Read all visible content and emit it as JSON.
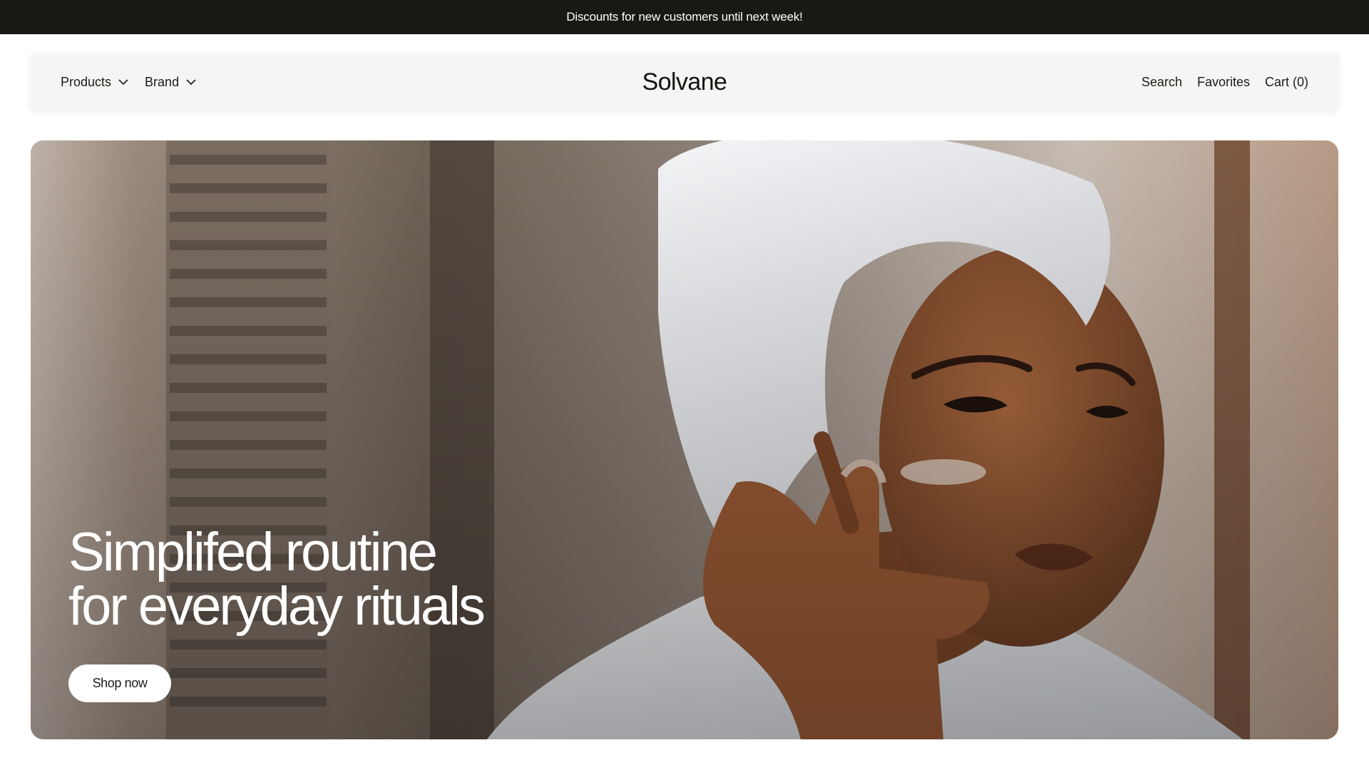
{
  "announcement": {
    "text": "Discounts for new customers until next week!"
  },
  "nav": {
    "left": [
      {
        "label": "Products",
        "icon": "chevron-down-icon"
      },
      {
        "label": "Brand",
        "icon": "chevron-down-icon"
      }
    ],
    "logo": "Solvane",
    "right": [
      {
        "label": "Search"
      },
      {
        "label": "Favorites"
      },
      {
        "label": "Cart (0)"
      }
    ]
  },
  "hero": {
    "title_line1": "Simplifed routine",
    "title_line2": "for everyday rituals",
    "cta_label": "Shop now"
  },
  "colors": {
    "announcement_bg": "#1a1814",
    "nav_bg": "#f5f5f3",
    "text": "#1c1a17",
    "cta_bg": "#ffffff"
  }
}
